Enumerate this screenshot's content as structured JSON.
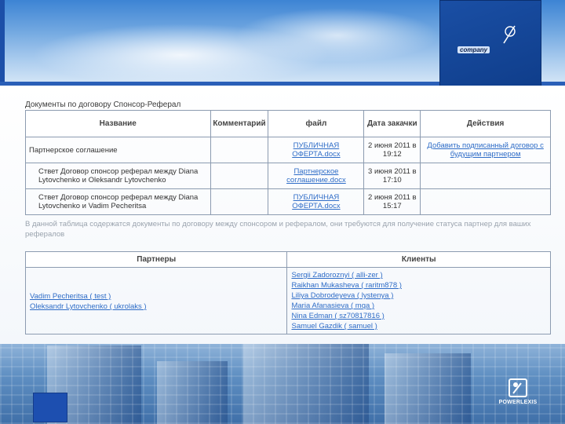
{
  "logo": {
    "tagline": "",
    "word": "company"
  },
  "doc_heading": "Документы по договору Спонсор-Реферал",
  "documents_table": {
    "headers": [
      "Название",
      "Комментарий",
      "файл",
      "Дата закачки",
      "Действия"
    ],
    "rows": [
      {
        "name": "Партнерское соглашение",
        "comment": "",
        "file": "ПУБЛИЧНАЯ ОФЕРТА.docx",
        "date": "2 июня 2011 в 19:12",
        "action": "Добавить подписанный договор с будущим партнером"
      },
      {
        "name": "Ствет Договор спонсор реферал между Diana Lytovchenko и Oleksandr Lytovchenko",
        "comment": "",
        "file": "Партнерское соглашение.docx",
        "date": "3 июня 2011 в 17:10",
        "action": ""
      },
      {
        "name": "Ствет Договор спонсор реферал между Diana Lytovchenko и Vadim Pecheritsa",
        "comment": "",
        "file": "ПУБЛИЧНАЯ ОФЕРТА.docx",
        "date": "2 июня 2011 в 15:17",
        "action": ""
      }
    ]
  },
  "note": "В данной таблица содержатся документы по договору между спонсором и рефералом, они требуются для получение статуса партнер для ваших рефералов",
  "partners_table": {
    "headers": [
      "Партнеры",
      "Клиенты"
    ],
    "partners": [
      "Vadim Pecheritsa ( test )",
      "Oleksandr Lytovchenko ( ukrolaks )"
    ],
    "clients": [
      "Sergii Zadoroznyi ( alli-zer )",
      "Raikhan Mukasheva ( raritm878 )",
      "Liliya Dobrodeyeva ( lystenya )",
      "Maria Afanasieva ( mqa )",
      "Nina Edman ( sz70817816 )",
      "Samuel Gazdik ( samuel )"
    ]
  },
  "brand": {
    "name": "POWERLEXIS"
  },
  "colors": {
    "accent": "#2a5fb8",
    "link": "#2e6cc7",
    "logo_bg": "#1a4fa5"
  }
}
